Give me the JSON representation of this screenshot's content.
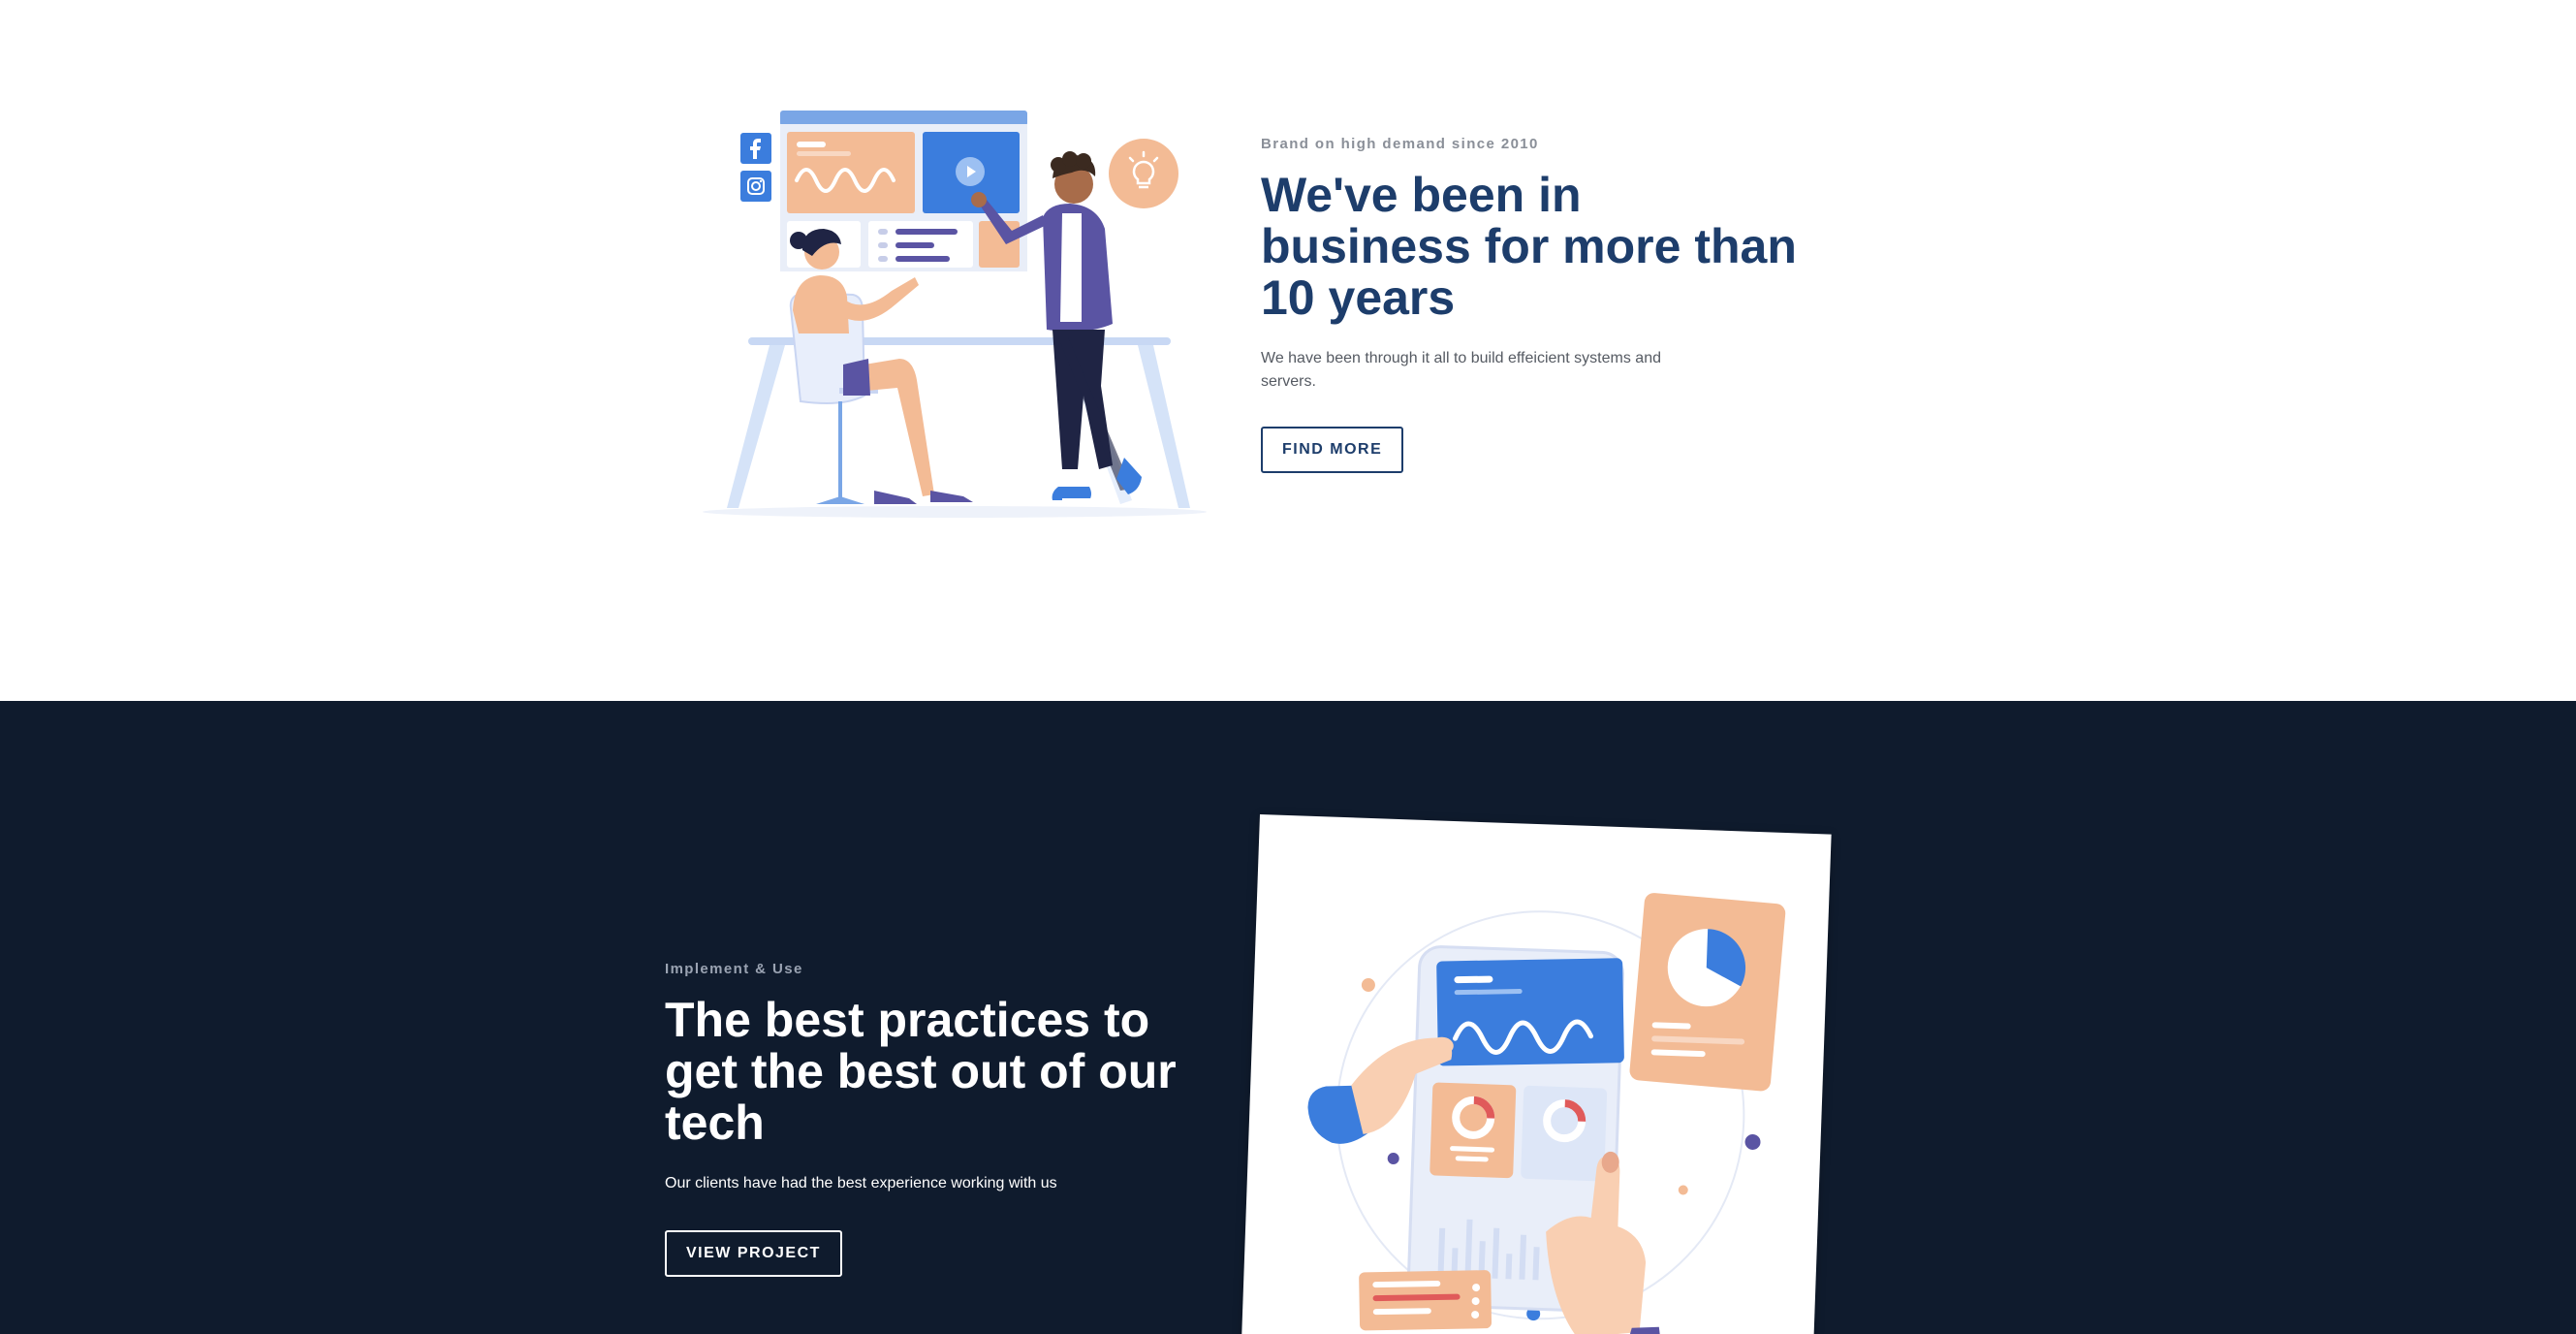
{
  "about": {
    "eyebrow": "Brand on high demand since 2010",
    "headline": "We've been in business for more than 10 years",
    "body": "We have been through it all to build effeicient systems and servers.",
    "cta_label": "FIND MORE"
  },
  "practices": {
    "eyebrow": "Implement & Use",
    "headline": "The best practices to get the best out of our tech",
    "body": "Our clients have had the best experience working with us",
    "cta_label": "VIEW PROJECT"
  },
  "colors": {
    "navy_heading": "#1d3d6b",
    "dark_section_bg": "#0f1b2d",
    "accent_blue": "#3b7ddd",
    "accent_peach": "#f3bb95",
    "accent_purple": "#5a54a3"
  },
  "icons": {
    "facebook": "facebook-icon",
    "instagram": "instagram-icon",
    "lightbulb": "lightbulb-icon",
    "play": "play-icon"
  }
}
